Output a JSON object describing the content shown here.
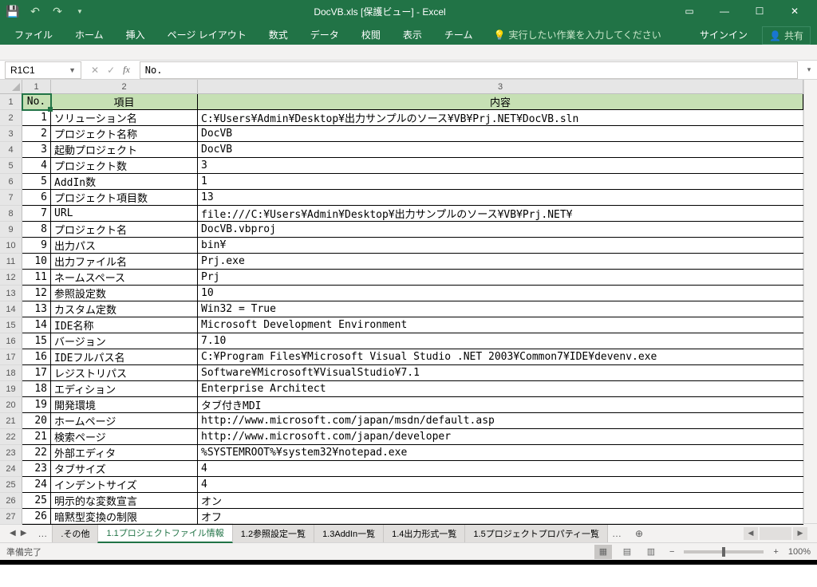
{
  "title": "DocVB.xls  [保護ビュー] - Excel",
  "ribbon": {
    "tabs": [
      "ファイル",
      "ホーム",
      "挿入",
      "ページ レイアウト",
      "数式",
      "データ",
      "校閲",
      "表示",
      "チーム"
    ],
    "tell_me": "実行したい作業を入力してください",
    "sign_in": "サインイン",
    "share": "共有"
  },
  "namebox": "R1C1",
  "formula_value": "No.",
  "col_headers": [
    "1",
    "2",
    "3"
  ],
  "table_headers": {
    "no": "No.",
    "item": "項目",
    "content": "内容"
  },
  "rows": [
    {
      "n": "1",
      "item": "ソリューション名",
      "val": "C:¥Users¥Admin¥Desktop¥出力サンプルのソース¥VB¥Prj.NET¥DocVB.sln"
    },
    {
      "n": "2",
      "item": "プロジェクト名称",
      "val": "DocVB"
    },
    {
      "n": "3",
      "item": "起動プロジェクト",
      "val": "DocVB"
    },
    {
      "n": "4",
      "item": "プロジェクト数",
      "val": "3"
    },
    {
      "n": "5",
      "item": "AddIn数",
      "val": "1"
    },
    {
      "n": "6",
      "item": "プロジェクト項目数",
      "val": "13"
    },
    {
      "n": "7",
      "item": "URL",
      "val": "file:///C:¥Users¥Admin¥Desktop¥出力サンプルのソース¥VB¥Prj.NET¥"
    },
    {
      "n": "8",
      "item": "プロジェクト名",
      "val": "DocVB.vbproj"
    },
    {
      "n": "9",
      "item": "出力パス",
      "val": "bin¥"
    },
    {
      "n": "10",
      "item": "出力ファイル名",
      "val": "Prj.exe"
    },
    {
      "n": "11",
      "item": "ネームスペース",
      "val": "Prj"
    },
    {
      "n": "12",
      "item": "参照設定数",
      "val": "10"
    },
    {
      "n": "13",
      "item": "カスタム定数",
      "val": "Win32 = True"
    },
    {
      "n": "14",
      "item": "IDE名称",
      "val": "Microsoft Development Environment"
    },
    {
      "n": "15",
      "item": "バージョン",
      "val": "7.10"
    },
    {
      "n": "16",
      "item": "IDEフルパス名",
      "val": "C:¥Program Files¥Microsoft Visual Studio .NET 2003¥Common7¥IDE¥devenv.exe"
    },
    {
      "n": "17",
      "item": "レジストリパス",
      "val": "Software¥Microsoft¥VisualStudio¥7.1"
    },
    {
      "n": "18",
      "item": "エディション",
      "val": "Enterprise Architect"
    },
    {
      "n": "19",
      "item": "開発環境",
      "val": "タブ付きMDI"
    },
    {
      "n": "20",
      "item": "ホームページ",
      "val": "http://www.microsoft.com/japan/msdn/default.asp"
    },
    {
      "n": "21",
      "item": "検索ページ",
      "val": "http://www.microsoft.com/japan/developer"
    },
    {
      "n": "22",
      "item": "外部エディタ",
      "val": "%SYSTEMROOT%¥system32¥notepad.exe"
    },
    {
      "n": "23",
      "item": "タブサイズ",
      "val": "4"
    },
    {
      "n": "24",
      "item": "インデントサイズ",
      "val": "4"
    },
    {
      "n": "25",
      "item": "明示的な変数宣言",
      "val": "オン"
    },
    {
      "n": "26",
      "item": "暗黙型変換の制限",
      "val": "オフ"
    }
  ],
  "sheet_tabs": {
    "other": ".その他",
    "active": "1.1プロジェクトファイル情報",
    "t2": "1.2参照設定一覧",
    "t3": "1.3AddIn一覧",
    "t4": "1.4出力形式一覧",
    "t5": "1.5プロジェクトプロパティ一覧"
  },
  "status": "準備完了",
  "zoom": "100%"
}
